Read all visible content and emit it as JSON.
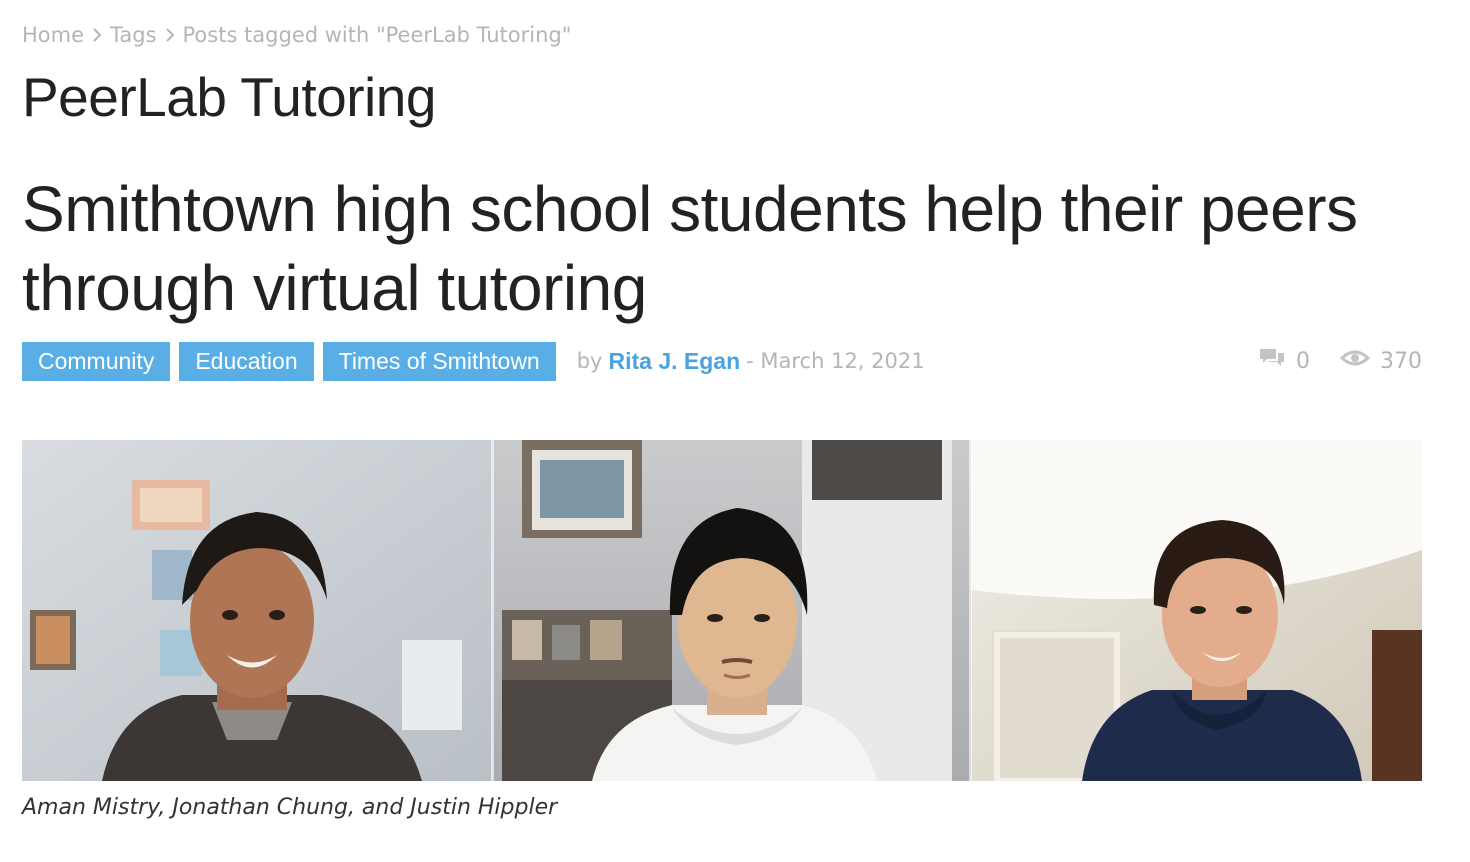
{
  "breadcrumb": {
    "items": [
      {
        "label": "Home"
      },
      {
        "label": "Tags"
      },
      {
        "label": "Posts tagged with \"PeerLab Tutoring\""
      }
    ]
  },
  "tag_title": "PeerLab Tutoring",
  "post": {
    "title": "Smithtown high school students help their peers through virtual tutoring",
    "categories": [
      {
        "label": "Community"
      },
      {
        "label": "Education"
      },
      {
        "label": "Times of Smithtown"
      }
    ],
    "byline_prefix": "by",
    "author": "Rita J. Egan",
    "date": "- March 12, 2021",
    "comment_count": "0",
    "view_count": "370",
    "caption": "Aman Mistry, Jonathan Chung, and Justin Hippler"
  },
  "colors": {
    "category_bg": "#5aaee6",
    "author_link": "#4aa3df",
    "muted_text": "#b5b5b5",
    "heading_text": "#222222"
  },
  "icons": {
    "breadcrumb_separator": "chevron-right-icon",
    "comments": "comments-icon",
    "views": "eye-icon"
  }
}
